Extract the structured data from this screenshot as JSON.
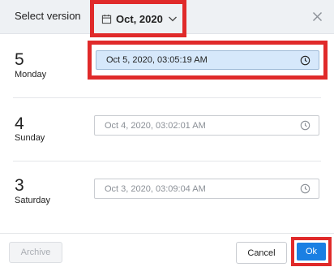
{
  "header": {
    "title": "Select version",
    "month_label": "Oct, 2020"
  },
  "versions": [
    {
      "day_num": "5",
      "day_name": "Monday",
      "timestamp": "Oct 5, 2020, 03:05:19 AM",
      "selected": true
    },
    {
      "day_num": "4",
      "day_name": "Sunday",
      "timestamp": "Oct 4, 2020, 03:02:01 AM",
      "selected": false
    },
    {
      "day_num": "3",
      "day_name": "Saturday",
      "timestamp": "Oct 3, 2020, 03:09:04 AM",
      "selected": false
    }
  ],
  "footer": {
    "archive_label": "Archive",
    "cancel_label": "Cancel",
    "ok_label": "Ok"
  },
  "colors": {
    "highlight_border": "#e02a2a",
    "primary": "#1a7fe3",
    "selected_field": "#d6e8fb"
  },
  "icons": [
    "calendar-icon",
    "chevron-down-icon",
    "close-icon",
    "clock-icon"
  ]
}
